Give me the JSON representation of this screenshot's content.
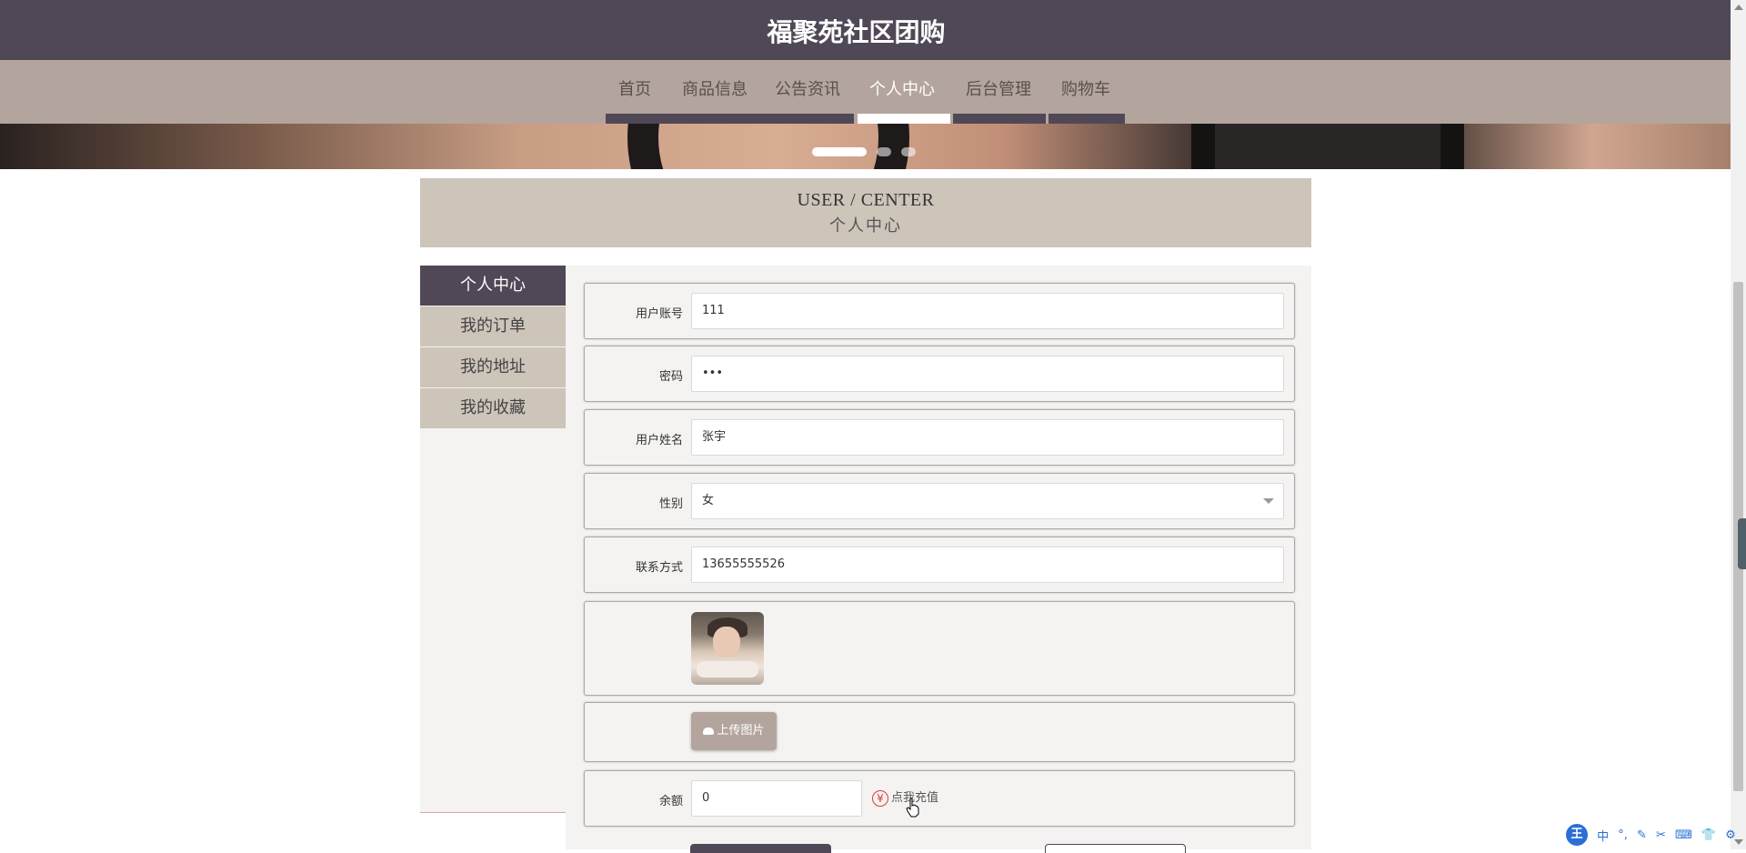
{
  "header": {
    "site_title": "福聚苑社区团购"
  },
  "nav": {
    "items": [
      {
        "label": "首页",
        "active": false
      },
      {
        "label": "商品信息",
        "active": false
      },
      {
        "label": "公告资讯",
        "active": false
      },
      {
        "label": "个人中心",
        "active": true
      },
      {
        "label": "后台管理",
        "active": false
      },
      {
        "label": "购物车",
        "active": false
      }
    ]
  },
  "banner": {
    "slides": 3,
    "active_slide": 1
  },
  "section_heading": {
    "en": "USER / CENTER",
    "cn": "个人中心"
  },
  "sidebar": {
    "items": [
      {
        "label": "个人中心",
        "active": true
      },
      {
        "label": "我的订单",
        "active": false
      },
      {
        "label": "我的地址",
        "active": false
      },
      {
        "label": "我的收藏",
        "active": false
      }
    ]
  },
  "form": {
    "account": {
      "label": "用户账号",
      "value": "111"
    },
    "password": {
      "label": "密码",
      "value": "•••"
    },
    "name": {
      "label": "用户姓名",
      "value": "张宇"
    },
    "gender": {
      "label": "性别",
      "value": "女"
    },
    "phone": {
      "label": "联系方式",
      "value": "13655555526"
    },
    "upload_label": "上传图片",
    "balance": {
      "label": "余额",
      "value": "0"
    },
    "recharge_label": "点我充值",
    "recharge_icon": "yen-icon"
  },
  "ime": {
    "logo": "王",
    "mode": "中"
  },
  "colors": {
    "header": "#504856",
    "nav": "#b3a59d",
    "panel": "#cdc4ba",
    "accent_red": "#e03a3a"
  }
}
